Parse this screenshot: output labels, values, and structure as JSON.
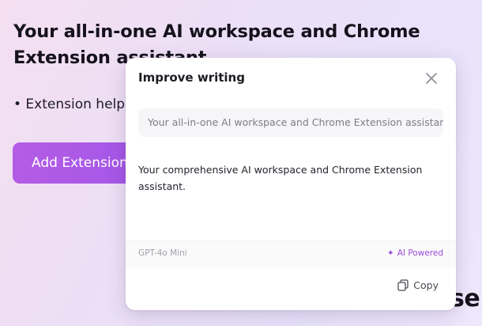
{
  "background": {
    "heading": "Your all-in-one AI workspace and Chrome Extension assistant",
    "bullet": "• Extension helps",
    "button_label": "Add Extension",
    "fragment": "se"
  },
  "dialog": {
    "title": "Improve writing",
    "source_text": "Your all-in-one AI workspace and Chrome Extension assistant",
    "result_text": "Your comprehensive AI workspace and Chrome Extension assistant.",
    "model": "GPT-4o Mini",
    "ai_powered_icon": "✦",
    "ai_powered_label": "AI Powered",
    "copy_label": "Copy"
  },
  "colors": {
    "accent": "#9b4dd9",
    "button_gradient_start": "#b45ce5",
    "button_gradient_end": "#a156e8"
  },
  "icons": {
    "close": "close-icon",
    "copy": "copy-icon",
    "sparkle": "sparkle-icon"
  }
}
